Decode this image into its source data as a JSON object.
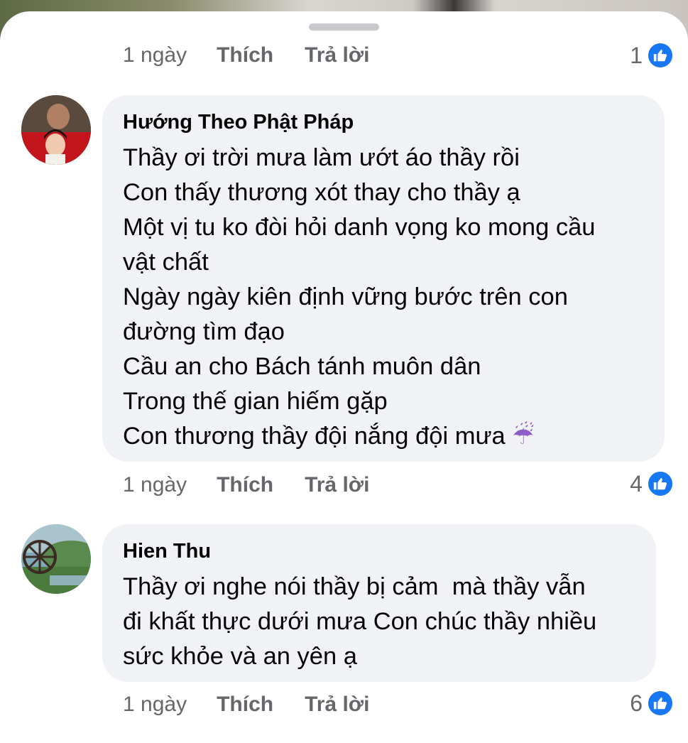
{
  "top_row": {
    "time": "1 ngày",
    "like_label": "Thích",
    "reply_label": "Trả lời",
    "reaction_count": "1"
  },
  "comments": [
    {
      "author": "Hướng Theo Phật Pháp",
      "lines": [
        "Thầy ơi trời mưa làm ướt áo thầy rồi",
        "Con thấy thương xót thay cho thầy ạ",
        "Một vị tu ko đòi hỏi danh vọng ko mong cầu",
        "vật chất",
        "Ngày ngày kiên định vững bước trên con",
        "đường tìm đạo",
        "Cầu an cho Bách tánh muôn dân",
        "Trong thế gian hiếm gặp",
        "Con thương thầy đội nắng đội mưa"
      ],
      "emoji": "☔",
      "time": "1 ngày",
      "like_label": "Thích",
      "reply_label": "Trả lời",
      "reaction_count": "4"
    },
    {
      "author": "Hien Thu",
      "lines": [
        "Thầy ơi nghe nói thầy bị cảm  mà thầy vẫn",
        "đi khất thực dưới mưa Con chúc thầy nhiều",
        "sức khỏe và an yên ạ"
      ],
      "time": "1 ngày",
      "like_label": "Thích",
      "reply_label": "Trả lời",
      "reaction_count": "6"
    }
  ],
  "icons": {
    "reaction": "like-thumbs-up-icon",
    "grabber": "sheet-grabber",
    "like_color": "#1877f2"
  }
}
